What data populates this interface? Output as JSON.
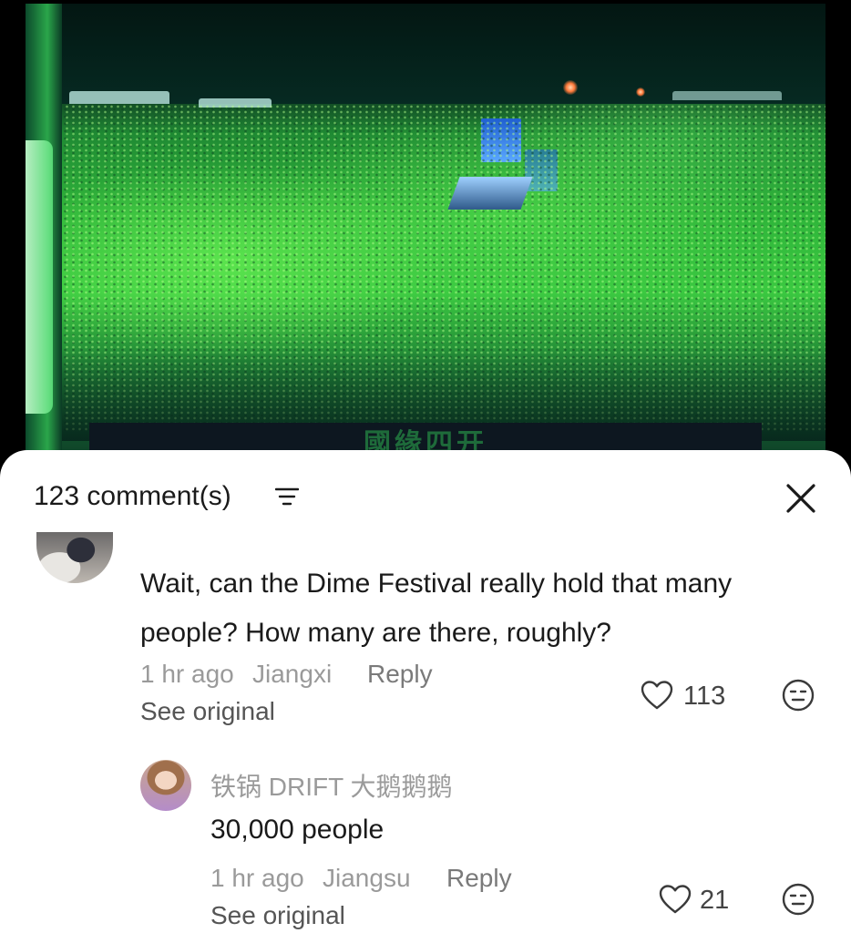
{
  "video": {
    "caption": "國緣四开"
  },
  "comments_panel": {
    "count_label": "123 comment(s)",
    "sort_icon": "filter-lines-icon",
    "close_icon": "close-x-icon"
  },
  "comments": [
    {
      "text": "Wait, can the Dime Festival really hold that many people? How many are there, roughly?",
      "time": "1 hr ago",
      "location": "Jiangxi",
      "reply_label": "Reply",
      "see_original_label": "See original",
      "likes": "113",
      "replies": [
        {
          "username": "铁锅 DRIFT 大鹅鹅鹅",
          "text": "30,000 people",
          "time": "1 hr ago",
          "location": "Jiangsu",
          "reply_label": "Reply",
          "see_original_label": "See original",
          "likes": "21"
        }
      ]
    }
  ],
  "colors": {
    "sheet_background": "#ffffff",
    "text_primary": "#1a1a1a",
    "text_secondary": "#9a9a9a",
    "crowd_green": "#3bc941"
  }
}
